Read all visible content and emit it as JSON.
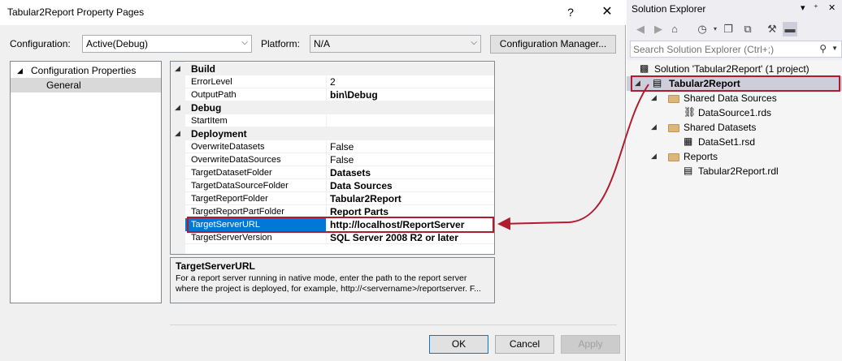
{
  "dialog": {
    "title": "Tabular2Report Property Pages",
    "help_glyph": "?",
    "close_glyph": "✕",
    "configuration_label": "Configuration:",
    "configuration_value": "Active(Debug)",
    "platform_label": "Platform:",
    "platform_value": "N/A",
    "config_manager_button": "Configuration Manager...",
    "tree": {
      "root": "Configuration Properties",
      "child": "General"
    },
    "grid": {
      "categories": {
        "build": "Build",
        "debug": "Debug",
        "deployment": "Deployment"
      },
      "rows": [
        {
          "name": "ErrorLevel",
          "value": "2"
        },
        {
          "name": "OutputPath",
          "value": "bin\\Debug"
        },
        {
          "name": "StartItem",
          "value": ""
        },
        {
          "name": "OverwriteDatasets",
          "value": "False"
        },
        {
          "name": "OverwriteDataSources",
          "value": "False"
        },
        {
          "name": "TargetDatasetFolder",
          "value": "Datasets"
        },
        {
          "name": "TargetDataSourceFolder",
          "value": "Data Sources"
        },
        {
          "name": "TargetReportFolder",
          "value": "Tabular2Report"
        },
        {
          "name": "TargetReportPartFolder",
          "value": "Report Parts"
        },
        {
          "name": "TargetServerURL",
          "value": "http://localhost/ReportServer"
        },
        {
          "name": "TargetServerVersion",
          "value": "SQL Server 2008 R2 or later"
        }
      ]
    },
    "description": {
      "title": "TargetServerURL",
      "text": "For a report server running in native mode, enter the path to the report server\nwhere the project is deployed, for example, http://<servername>/reportserver. F..."
    },
    "buttons": {
      "ok": "OK",
      "cancel": "Cancel",
      "apply": "Apply"
    }
  },
  "solution_explorer": {
    "title": "Solution Explorer",
    "search_placeholder": "Search Solution Explorer (Ctrl+;)",
    "items": [
      {
        "label": "Solution 'Tabular2Report' (1 project)"
      },
      {
        "label": "Tabular2Report"
      },
      {
        "label": "Shared Data Sources"
      },
      {
        "label": "DataSource1.rds"
      },
      {
        "label": "Shared Datasets"
      },
      {
        "label": "DataSet1.rsd"
      },
      {
        "label": "Reports"
      },
      {
        "label": "Tabular2Report.rdl"
      }
    ]
  },
  "colors": {
    "highlight": "#b01c2e",
    "selection": "#0078d7"
  }
}
